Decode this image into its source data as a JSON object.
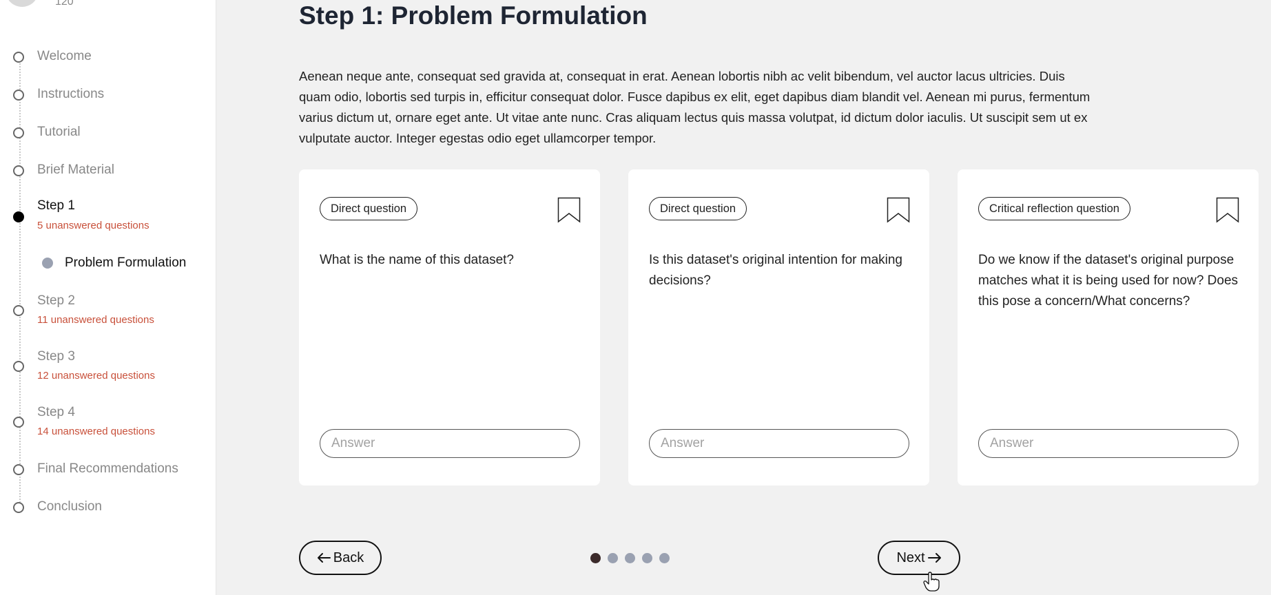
{
  "sidebar": {
    "user_count": "120",
    "items": [
      {
        "label": "Welcome"
      },
      {
        "label": "Instructions"
      },
      {
        "label": "Tutorial"
      },
      {
        "label": "Brief Material"
      },
      {
        "label": "Step 1",
        "status": "5 unanswered questions",
        "active": true,
        "subitems": [
          {
            "label": "Problem Formulation"
          }
        ]
      },
      {
        "label": "Step 2",
        "status": "11 unanswered questions"
      },
      {
        "label": "Step 3",
        "status": "12 unanswered questions"
      },
      {
        "label": "Step 4",
        "status": "14 unanswered questions"
      },
      {
        "label": "Final Recommendations"
      },
      {
        "label": "Conclusion"
      }
    ]
  },
  "main": {
    "title": "Step 1: Problem Formulation",
    "intro": "Aenean neque ante, consequat sed gravida at, consequat in erat. Aenean lobortis nibh ac velit bibendum, vel auctor lacus ultricies. Duis quam odio, lobortis sed turpis in, efficitur consequat dolor. Fusce dapibus ex elit, eget dapibus diam blandit vel. Aenean mi purus, fermentum varius dictum ut, ornare eget ante. Ut vitae ante nunc. Cras aliquam lectus quis massa volutpat, id dictum dolor iaculis. Ut suscipit sem ut ex vulputate auctor. Integer egestas odio eget ullamcorper tempor.",
    "cards": [
      {
        "tag": "Direct question",
        "question": "What is the name of this dataset?",
        "answer_placeholder": "Answer",
        "answer_value": ""
      },
      {
        "tag": "Direct question",
        "question": "Is this dataset's original intention for making decisions?",
        "answer_placeholder": "Answer",
        "answer_value": ""
      },
      {
        "tag": "Critical reflection question",
        "question": "Do we know if the dataset's original purpose matches what it is being used for now? Does this pose a concern/What concerns?",
        "answer_placeholder": "Answer",
        "answer_value": ""
      }
    ]
  },
  "footer": {
    "back_label": "Back",
    "next_label": "Next",
    "back_icon": "arrow-left-icon",
    "next_icon": "arrow-right-icon",
    "pager": {
      "current": 1,
      "total": 5
    }
  },
  "colors": {
    "background": "#f1f1f1",
    "unanswered": "#c8503a",
    "pager_active": "#3b2a2a",
    "pager_inactive": "#9aa1b1"
  }
}
